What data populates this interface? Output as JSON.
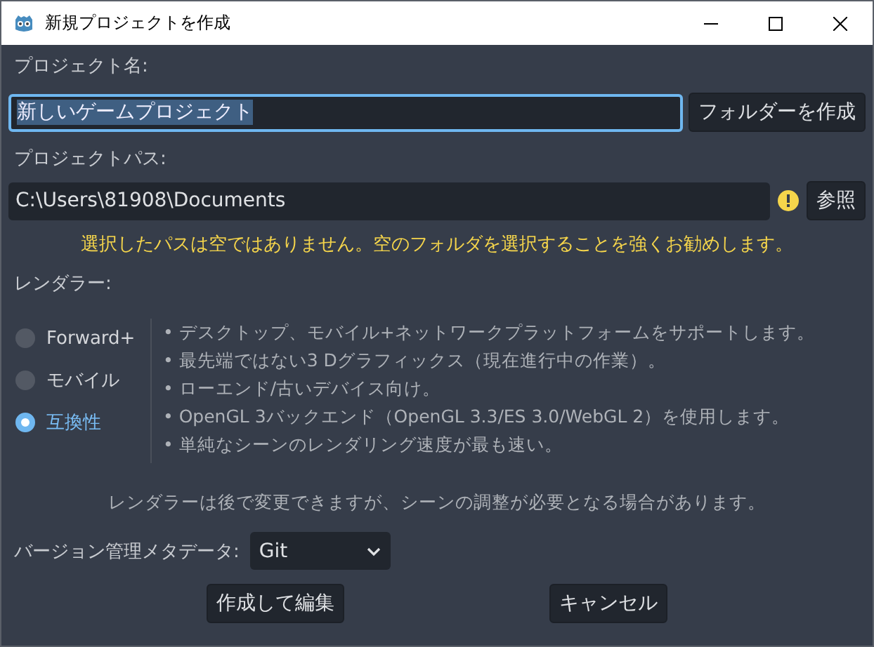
{
  "window": {
    "title": "新規プロジェクトを作成"
  },
  "project_name": {
    "label": "プロジェクト名:",
    "value": "新しいゲームプロジェクト",
    "create_folder_button": "フォルダーを作成"
  },
  "project_path": {
    "label": "プロジェクトパス:",
    "value": "C:\\Users\\81908\\Documents",
    "browse_button": "参照",
    "warning": "選択したパスは空ではありません。空のフォルダを選択することを強くお勧めします。"
  },
  "renderer": {
    "label": "レンダラー:",
    "options": [
      {
        "label": "Forward+",
        "selected": false
      },
      {
        "label": "モバイル",
        "selected": false
      },
      {
        "label": "互換性",
        "selected": true
      }
    ],
    "description": [
      "•  デスクトップ、モバイル+ネットワークプラットフォームをサポートします。",
      "•  最先端ではない3 Dグラフィックス（現在進行中の作業）。",
      "•  ローエンド/古いデバイス向け。",
      "•  OpenGL 3バックエンド（OpenGL 3.3/ES 3.0/WebGL 2）を使用します。",
      "•  単純なシーンのレンダリング速度が最も速い。"
    ],
    "note": "レンダラーは後で変更できますが、シーンの調整が必要となる場合があります。"
  },
  "version_control": {
    "label": "バージョン管理メタデータ:",
    "value": "Git"
  },
  "buttons": [
    "作成して編集",
    "キャンセル"
  ]
}
